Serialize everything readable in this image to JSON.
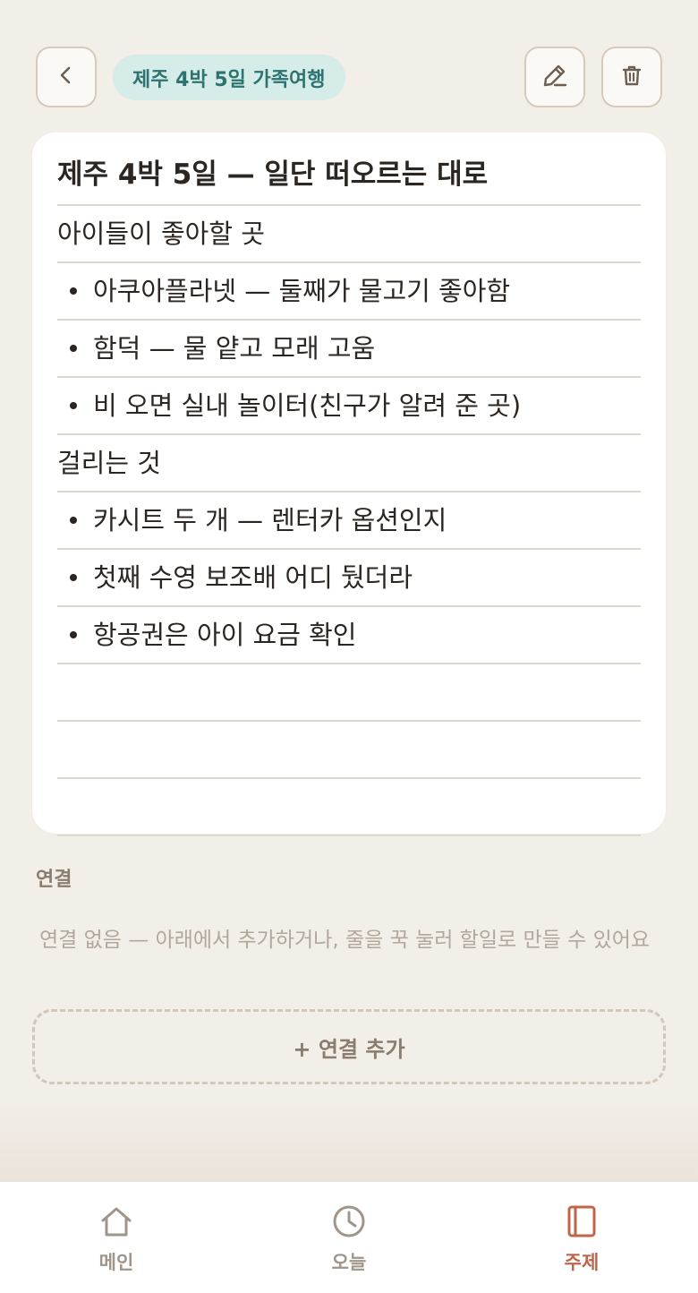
{
  "header": {
    "topic_chip": "제주 4박 5일 가족여행",
    "back_icon": "chevron-left-icon",
    "edit_icon": "pencil-icon",
    "delete_icon": "trash-icon"
  },
  "note": {
    "title": "제주 4박 5일 — 일단 떠오르는 대로",
    "lines": [
      {
        "text": "아이들이 좋아할 곳",
        "bullet": false
      },
      {
        "text": "아쿠아플라넷 — 둘째가 물고기 좋아함",
        "bullet": true
      },
      {
        "text": "함덕 — 물 얕고 모래 고움",
        "bullet": true
      },
      {
        "text": "비 오면 실내 놀이터(친구가 알려 준 곳)",
        "bullet": true
      },
      {
        "text": "걸리는 것",
        "bullet": false
      },
      {
        "text": "카시트 두 개 — 렌터카 옵션인지",
        "bullet": true
      },
      {
        "text": "첫째 수영 보조배 어디 뒀더라",
        "bullet": true
      },
      {
        "text": "항공권은 아이 요금 확인",
        "bullet": true
      },
      {
        "text": "",
        "bullet": false
      },
      {
        "text": "",
        "bullet": false
      },
      {
        "text": "",
        "bullet": false
      }
    ]
  },
  "links": {
    "heading": "연결",
    "empty_text": "연결 없음 — 아래에서 추가하거나, 줄을 꾹 눌러 할일로 만들 수 있어요",
    "add_button": "+ 연결 추가"
  },
  "nav": {
    "items": [
      {
        "label": "메인",
        "icon": "home-icon"
      },
      {
        "label": "오늘",
        "icon": "clock-icon"
      },
      {
        "label": "주제",
        "icon": "notebook-icon",
        "active": true
      }
    ]
  },
  "colors": {
    "background": "#f2eee8",
    "chip_bg": "#d5ece9",
    "chip_text": "#2d7470",
    "active_nav": "#c0654a",
    "inactive_nav": "#a0958a"
  }
}
